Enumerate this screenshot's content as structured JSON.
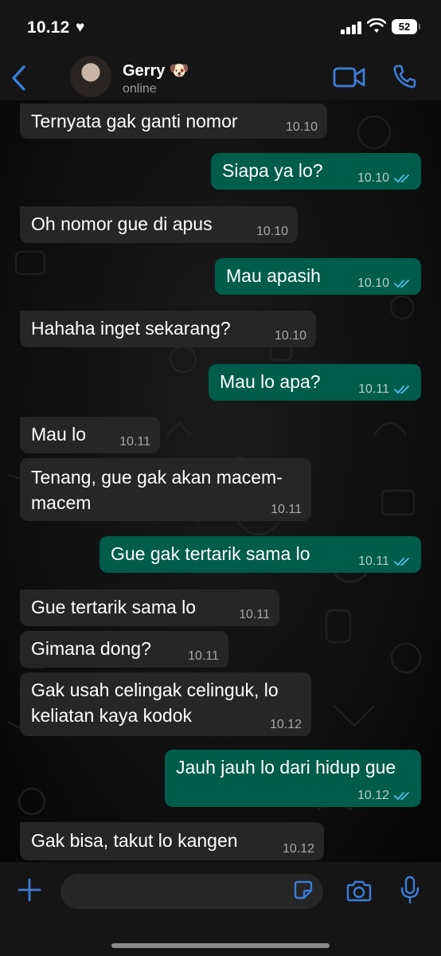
{
  "status_bar": {
    "time": "10.12",
    "battery": "52"
  },
  "header": {
    "contact_name": "Gerry 🐶",
    "contact_status": "online"
  },
  "colors": {
    "accent": "#3b7dd8",
    "outgoing_bubble": "#005c4b",
    "incoming_bubble": "#262626",
    "read_ticks": "#53bdeb"
  },
  "messages": [
    {
      "dir": "in",
      "text": "Ternyata gak ganti nomor",
      "time": "10.10"
    },
    {
      "dir": "out",
      "text": "Siapa ya lo?",
      "time": "10.10",
      "read": true
    },
    {
      "dir": "in",
      "text": "Oh nomor gue di apus",
      "time": "10.10"
    },
    {
      "dir": "out",
      "text": "Mau apasih",
      "time": "10.10",
      "read": true
    },
    {
      "dir": "in",
      "text": "Hahaha inget sekarang?",
      "time": "10.10"
    },
    {
      "dir": "out",
      "text": "Mau lo apa?",
      "time": "10.11",
      "read": true
    },
    {
      "dir": "in",
      "text": "Mau lo",
      "time": "10.11"
    },
    {
      "dir": "in",
      "text": "Tenang, gue gak akan macem-macem",
      "time": "10.11"
    },
    {
      "dir": "out",
      "text": "Gue gak tertarik sama lo",
      "time": "10.11",
      "read": true
    },
    {
      "dir": "in",
      "text": "Gue tertarik sama lo",
      "time": "10.11"
    },
    {
      "dir": "in",
      "text": "Gimana dong?",
      "time": "10.11"
    },
    {
      "dir": "in",
      "text": "Gak usah celingak celinguk, lo keliatan kaya kodok",
      "time": "10.12"
    },
    {
      "dir": "out",
      "text": "Jauh jauh lo dari hidup gue",
      "time": "10.12",
      "read": true
    },
    {
      "dir": "in",
      "text": "Gak bisa, takut lo kangen",
      "time": "10.12"
    }
  ]
}
